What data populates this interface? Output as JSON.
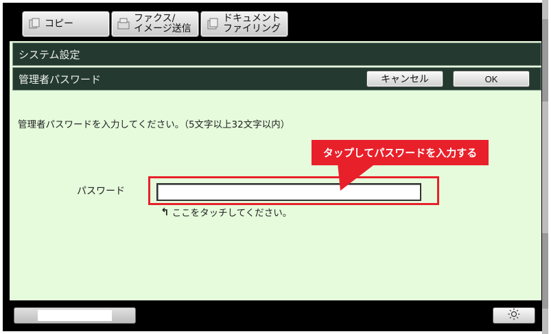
{
  "tabs": {
    "copy": {
      "label": "コピー",
      "icon": "copy-icon"
    },
    "fax": {
      "line1": "ファクス/",
      "line2": "イメージ送信",
      "icon": "fax-icon"
    },
    "document": {
      "line1": "ドキュメント",
      "line2": "ファイリング",
      "icon": "document-filing-icon"
    }
  },
  "header": {
    "title": "システム設定",
    "subtitle": "管理者パスワード"
  },
  "buttons": {
    "cancel": "キャンセル",
    "ok": "OK"
  },
  "instruction": "管理者パスワードを入力してください。（5文字以上32文字以内）",
  "callout": "タップしてパスワードを入力する",
  "password": {
    "label": "パスワード",
    "value": "",
    "hint": "ここをタッチしてください。"
  },
  "colors": {
    "accent": "#e8202a",
    "panel": "#e5fbdc",
    "header": "#243a30"
  }
}
